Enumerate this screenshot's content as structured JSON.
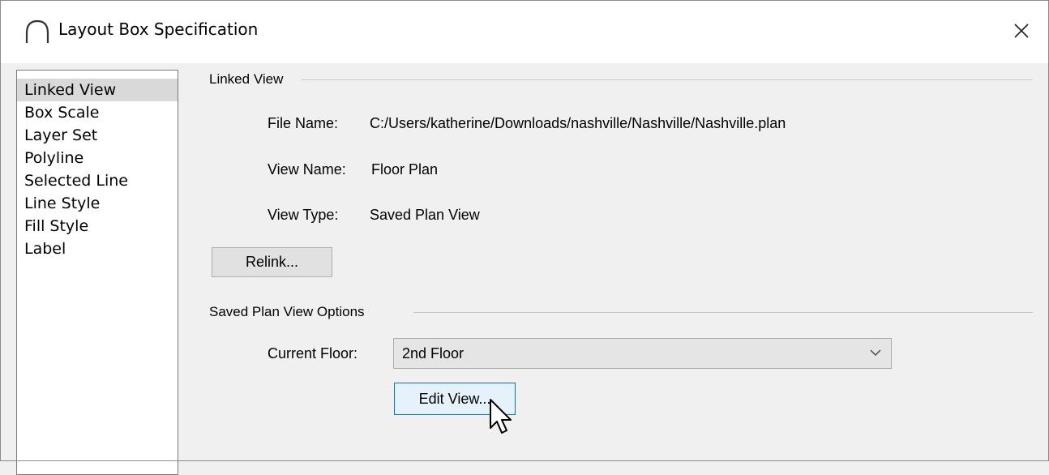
{
  "window": {
    "title": "Layout Box Specification",
    "icons": {
      "app": "arc-icon",
      "close": "close-icon"
    }
  },
  "sidebar": {
    "items": [
      {
        "label": "Linked View",
        "selected": true
      },
      {
        "label": "Box Scale"
      },
      {
        "label": "Layer Set"
      },
      {
        "label": "Polyline"
      },
      {
        "label": "Selected Line"
      },
      {
        "label": "Line Style"
      },
      {
        "label": "Fill Style"
      },
      {
        "label": "Label"
      }
    ]
  },
  "linked_view": {
    "group_label": "Linked View",
    "file_name_label": "File Name:",
    "file_name_value": "C:/Users/katherine/Downloads/nashville/Nashville/Nashville.plan",
    "view_name_label": "View Name:",
    "view_name_value": "Floor Plan",
    "view_type_label": "View Type:",
    "view_type_value": "Saved Plan View",
    "relink_label": "Relink..."
  },
  "saved_plan_view_options": {
    "group_label": "Saved Plan View Options",
    "current_floor_label": "Current Floor:",
    "current_floor_value": "2nd Floor",
    "edit_view_label": "Edit View..."
  },
  "colors": {
    "focus_border": "#0078d7",
    "selected_item_bg": "#d9d9d9",
    "dialog_bg": "#f0f0f0"
  }
}
